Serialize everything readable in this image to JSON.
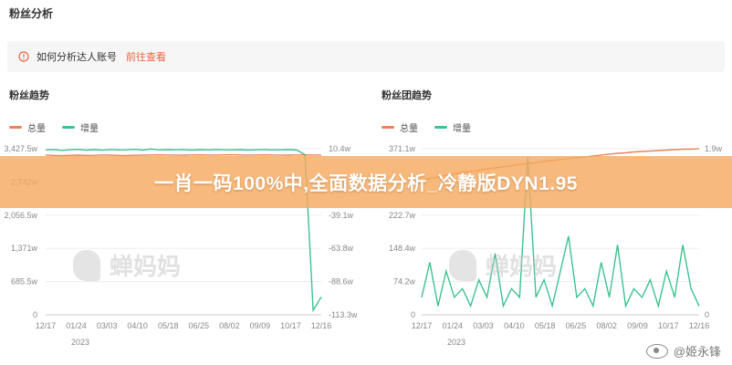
{
  "page_title": "粉丝分析",
  "notice": {
    "text": "如何分析达人账号",
    "link": "前往查看"
  },
  "banner_text": "一肖一码100%中,全面数据分析_冷静版DYN1.95",
  "watermark_text": "蝉妈妈",
  "corner_watermark": "@姬永锋",
  "legend": {
    "total": "总量",
    "increase": "增量"
  },
  "colors": {
    "total": "#e8845c",
    "increase": "#3cc28f",
    "accent": "#e8643c"
  },
  "chart_data": [
    {
      "title": "粉丝趋势",
      "type": "line",
      "x_ticks": [
        "12/17",
        "01/24",
        "03/03",
        "04/10",
        "05/18",
        "06/25",
        "08/02",
        "09/09",
        "10/17",
        "12/16"
      ],
      "x_year": "2023",
      "y_left_ticks": [
        "0",
        "685.5w",
        "1,371w",
        "2,056.5w",
        "2,742w",
        "3,427.5w"
      ],
      "y_right_ticks": [
        "-113.3w",
        "-88.6w",
        "-63.8w",
        "-39.1w",
        "",
        "10.4w"
      ],
      "y_left_range": [
        0,
        3427.5
      ],
      "y_right_range": [
        -113.3,
        10.4
      ],
      "series": [
        {
          "name": "总量",
          "axis": "left",
          "values": [
            3300,
            3290,
            3285,
            3290,
            3295,
            3290,
            3292,
            3300,
            3295,
            3290,
            3288,
            3292,
            3295,
            3300,
            3302,
            3300,
            3298,
            3296,
            3300,
            3302,
            3300,
            3298,
            3302,
            3304,
            3300,
            3298,
            3300,
            3302,
            3300,
            3298,
            3296,
            3300,
            3302,
            3300,
            3298
          ]
        },
        {
          "name": "增量",
          "axis": "right",
          "values": [
            9.5,
            9.8,
            9.2,
            9.6,
            9.9,
            9.4,
            9.7,
            9.3,
            9.8,
            9.5,
            9.6,
            9.9,
            9.4,
            10.2,
            9.5,
            9.7,
            9.6,
            9.8,
            9.4,
            9.7,
            9.5,
            9.8,
            9.6,
            9.5,
            9.7,
            9.4,
            9.6,
            9.8,
            9.5,
            9.6,
            9.7,
            9.4,
            6.0,
            -110.0,
            -100.0
          ]
        }
      ]
    },
    {
      "title": "粉丝团趋势",
      "type": "line",
      "x_ticks": [
        "12/17",
        "01/24",
        "03/03",
        "04/10",
        "05/18",
        "06/25",
        "08/02",
        "09/09",
        "10/17",
        "12/16"
      ],
      "x_year": "2023",
      "y_left_ticks": [
        "0",
        "74.2w",
        "148.4w",
        "222.7w",
        "",
        "371.1w"
      ],
      "y_right_ticks": [
        "0",
        "",
        "",
        "",
        "",
        "1.9w"
      ],
      "y_left_range": [
        0,
        371.1
      ],
      "y_right_range": [
        0,
        1.9
      ],
      "series": [
        {
          "name": "总量",
          "axis": "left",
          "values": [
            300,
            305,
            308,
            312,
            315,
            318,
            320,
            323,
            326,
            328,
            331,
            333,
            336,
            338,
            340,
            343,
            345,
            347,
            349,
            351,
            353,
            355,
            357,
            359,
            361,
            362,
            364,
            365,
            366,
            367,
            368,
            369,
            370,
            370,
            371
          ]
        },
        {
          "name": "增量",
          "axis": "right",
          "values": [
            0.2,
            0.6,
            0.1,
            0.5,
            0.2,
            0.3,
            0.1,
            0.4,
            0.2,
            0.7,
            0.1,
            0.3,
            0.2,
            1.8,
            0.2,
            0.4,
            0.1,
            0.5,
            0.9,
            0.2,
            0.3,
            0.1,
            0.6,
            0.2,
            0.8,
            0.1,
            0.3,
            0.2,
            0.4,
            0.1,
            0.5,
            0.2,
            0.8,
            0.3,
            0.1
          ]
        }
      ]
    }
  ]
}
